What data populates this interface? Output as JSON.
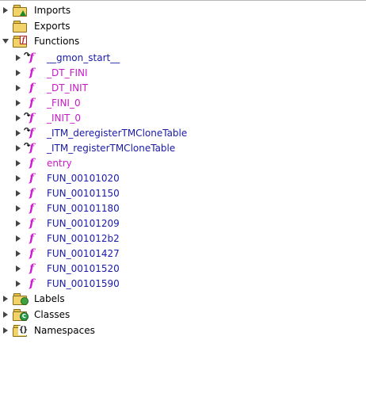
{
  "tree": {
    "folders": {
      "imports": {
        "label": "Imports",
        "icon": "folder-import-icon",
        "state": "collapsed"
      },
      "exports": {
        "label": "Exports",
        "icon": "folder-icon",
        "state": "leaf"
      },
      "functions": {
        "label": "Functions",
        "icon": "folder-functions-icon",
        "state": "expanded"
      },
      "labels": {
        "label": "Labels",
        "icon": "folder-labels-icon",
        "state": "collapsed"
      },
      "classes": {
        "label": "Classes",
        "icon": "folder-classes-icon",
        "state": "collapsed"
      },
      "namespaces": {
        "label": "Namespaces",
        "icon": "folder-namespaces-icon",
        "state": "collapsed"
      }
    },
    "functions": [
      {
        "name": "__gmon_start__",
        "color": "#1a1aa6",
        "external": true,
        "expandable": true
      },
      {
        "name": "_DT_FINI",
        "color": "#c81ac8",
        "external": false,
        "expandable": true
      },
      {
        "name": "_DT_INIT",
        "color": "#c81ac8",
        "external": false,
        "expandable": true
      },
      {
        "name": "_FINI_0",
        "color": "#c81ac8",
        "external": false,
        "expandable": true
      },
      {
        "name": "_INIT_0",
        "color": "#c81ac8",
        "external": true,
        "expandable": true
      },
      {
        "name": "_ITM_deregisterTMCloneTable",
        "color": "#1a1aa6",
        "external": true,
        "expandable": true
      },
      {
        "name": "_ITM_registerTMCloneTable",
        "color": "#1a1aa6",
        "external": true,
        "expandable": true
      },
      {
        "name": "entry",
        "color": "#c81ac8",
        "external": false,
        "expandable": true
      },
      {
        "name": "FUN_00101020",
        "color": "#1a1aa6",
        "external": false,
        "expandable": true
      },
      {
        "name": "FUN_00101150",
        "color": "#1a1aa6",
        "external": false,
        "expandable": true
      },
      {
        "name": "FUN_00101180",
        "color": "#1a1aa6",
        "external": false,
        "expandable": true
      },
      {
        "name": "FUN_00101209",
        "color": "#1a1aa6",
        "external": false,
        "expandable": true
      },
      {
        "name": "FUN_001012b2",
        "color": "#1a1aa6",
        "external": false,
        "expandable": true
      },
      {
        "name": "FUN_00101427",
        "color": "#1a1aa6",
        "external": false,
        "expandable": true
      },
      {
        "name": "FUN_00101520",
        "color": "#1a1aa6",
        "external": false,
        "expandable": true
      },
      {
        "name": "FUN_00101590",
        "color": "#1a1aa6",
        "external": false,
        "expandable": true
      }
    ],
    "function_icon_glyph": "f",
    "external_hook_glyph": "↷"
  }
}
